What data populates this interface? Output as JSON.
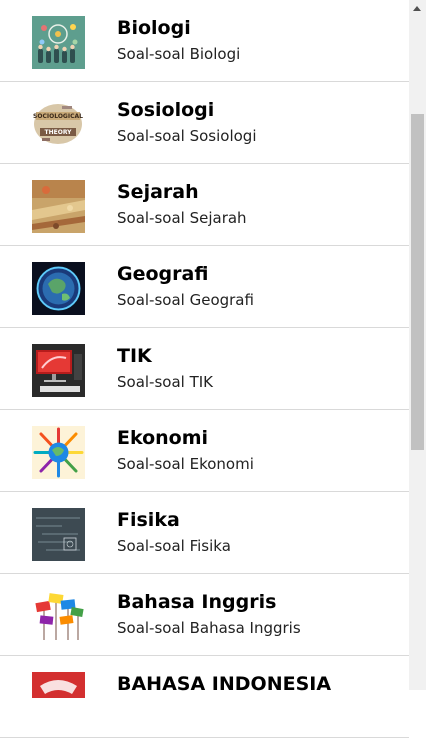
{
  "subjects": [
    {
      "title": "Biologi",
      "subtitle": "Soal-soal Biologi",
      "icon": "biology-thumbnail"
    },
    {
      "title": "Sosiologi",
      "subtitle": "Soal-soal Sosiologi",
      "icon": "sociology-thumbnail"
    },
    {
      "title": "Sejarah",
      "subtitle": "Soal-soal Sejarah",
      "icon": "history-thumbnail"
    },
    {
      "title": "Geografi",
      "subtitle": "Soal-soal Geografi",
      "icon": "geography-thumbnail"
    },
    {
      "title": "TIK",
      "subtitle": "Soal-soal TIK",
      "icon": "ict-thumbnail"
    },
    {
      "title": "Ekonomi",
      "subtitle": "Soal-soal Ekonomi",
      "icon": "economy-thumbnail"
    },
    {
      "title": "Fisika",
      "subtitle": "Soal-soal Fisika",
      "icon": "physics-thumbnail"
    },
    {
      "title": "Bahasa Inggris",
      "subtitle": "Soal-soal Bahasa Inggris",
      "icon": "english-thumbnail"
    },
    {
      "title": "BAHASA INDONESIA",
      "icon": "indonesian-thumbnail"
    }
  ],
  "thumbnail_text": {
    "sociology": [
      "SOCIOLOGICAL",
      "THEORY"
    ]
  },
  "colors": {
    "divider": "#d9d9d9",
    "scrollbar_track": "#f1f1f1",
    "scrollbar_thumb": "#c1c1c1"
  }
}
